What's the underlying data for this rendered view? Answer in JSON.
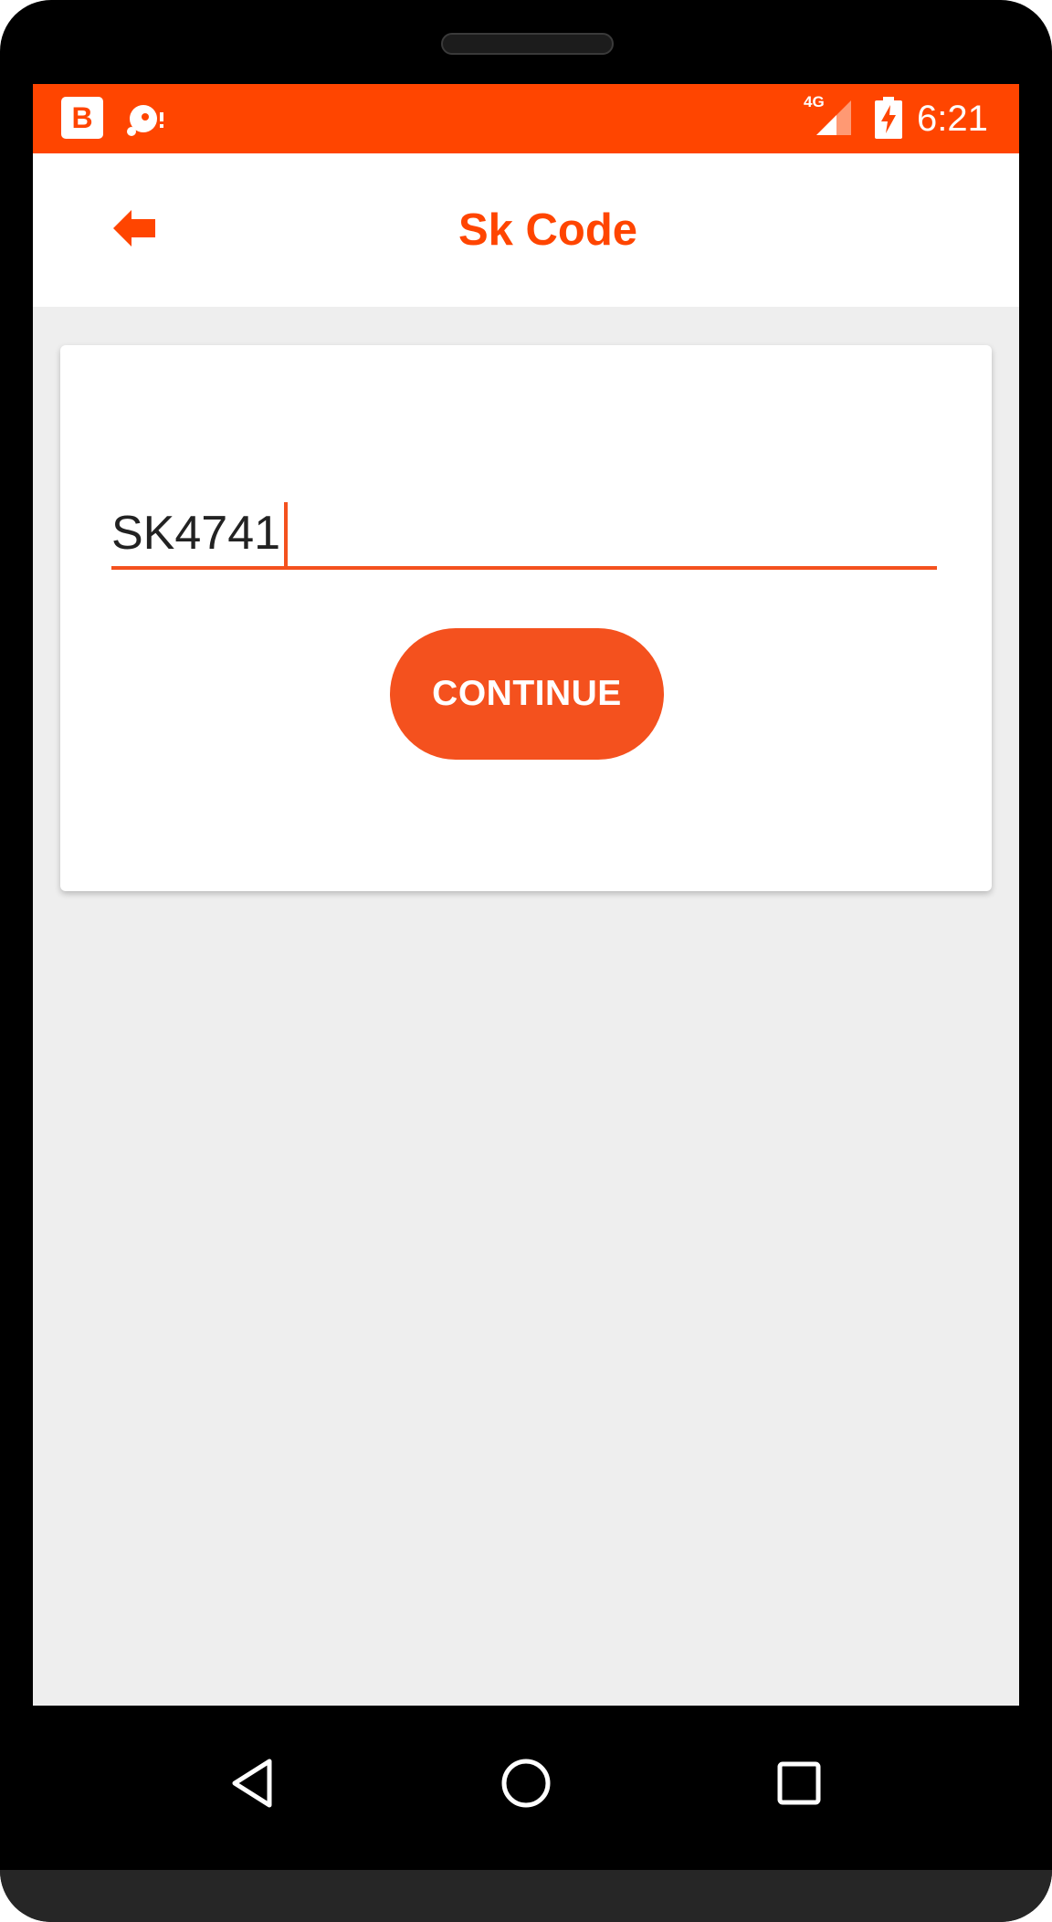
{
  "colors": {
    "accent": "#ff4500",
    "button": "#f4511e",
    "background": "#eeeeee",
    "card": "#ffffff"
  },
  "status_bar": {
    "network_type": "4G",
    "time": "6:21",
    "icons": [
      "b-app-icon",
      "disc-notification-icon",
      "signal-icon",
      "battery-charging-icon"
    ],
    "b_icon_letter": "B"
  },
  "app_bar": {
    "title": "Sk Code",
    "back_icon": "arrow-left-icon"
  },
  "form": {
    "code_value": "SK4741",
    "continue_label": "CONTINUE"
  },
  "nav_bar": {
    "icons": [
      "back-triangle-icon",
      "home-circle-icon",
      "recents-square-icon"
    ]
  }
}
